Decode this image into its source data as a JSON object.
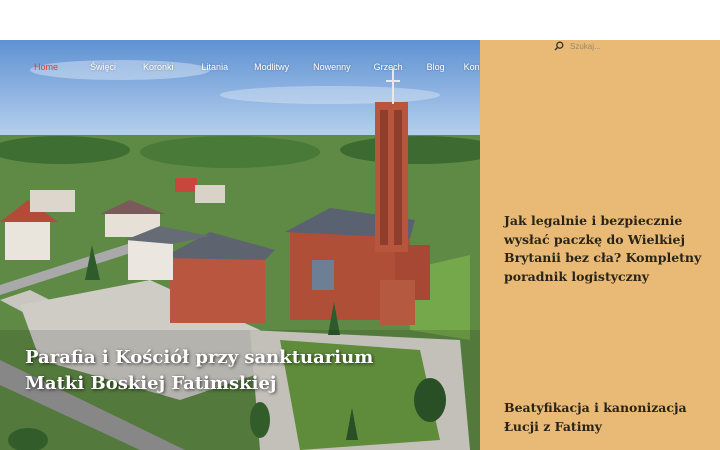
{
  "nav": {
    "items": [
      {
        "label": "Home",
        "active": true
      },
      {
        "label": "Święci"
      },
      {
        "label": "Koronki"
      },
      {
        "label": "Litania"
      },
      {
        "label": "Modlitwy"
      },
      {
        "label": "Nowenny"
      },
      {
        "label": "Grzech"
      },
      {
        "label": "Blog"
      },
      {
        "label": "Kontakt"
      }
    ]
  },
  "search": {
    "placeholder": "Szukaj..."
  },
  "hero": {
    "title": "Parafia i Kościół przy sanktuarium Matki Boskiej Fatimskiej"
  },
  "sidebar": {
    "posts": [
      {
        "title": "Jak legalnie i bezpiecznie wysłać paczkę do Wielkiej Brytanii bez cła? Kompletny poradnik logistyczny"
      },
      {
        "title": "Beatyfikacja i kanonizacja Łucji z Fatimy"
      }
    ]
  },
  "colors": {
    "accent": "#e03a2f",
    "sidebar": "#e8ba76",
    "sky": "#6f9fd8"
  }
}
